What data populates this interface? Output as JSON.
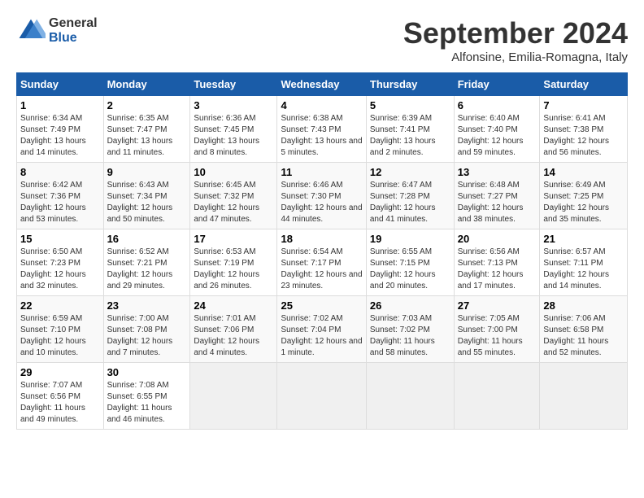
{
  "header": {
    "logo_line1": "General",
    "logo_line2": "Blue",
    "month": "September 2024",
    "location": "Alfonsine, Emilia-Romagna, Italy"
  },
  "columns": [
    "Sunday",
    "Monday",
    "Tuesday",
    "Wednesday",
    "Thursday",
    "Friday",
    "Saturday"
  ],
  "weeks": [
    [
      {
        "day": "1",
        "sunrise": "6:34 AM",
        "sunset": "7:49 PM",
        "daylight": "13 hours and 14 minutes"
      },
      {
        "day": "2",
        "sunrise": "6:35 AM",
        "sunset": "7:47 PM",
        "daylight": "13 hours and 11 minutes"
      },
      {
        "day": "3",
        "sunrise": "6:36 AM",
        "sunset": "7:45 PM",
        "daylight": "13 hours and 8 minutes"
      },
      {
        "day": "4",
        "sunrise": "6:38 AM",
        "sunset": "7:43 PM",
        "daylight": "13 hours and 5 minutes"
      },
      {
        "day": "5",
        "sunrise": "6:39 AM",
        "sunset": "7:41 PM",
        "daylight": "13 hours and 2 minutes"
      },
      {
        "day": "6",
        "sunrise": "6:40 AM",
        "sunset": "7:40 PM",
        "daylight": "12 hours and 59 minutes"
      },
      {
        "day": "7",
        "sunrise": "6:41 AM",
        "sunset": "7:38 PM",
        "daylight": "12 hours and 56 minutes"
      }
    ],
    [
      {
        "day": "8",
        "sunrise": "6:42 AM",
        "sunset": "7:36 PM",
        "daylight": "12 hours and 53 minutes"
      },
      {
        "day": "9",
        "sunrise": "6:43 AM",
        "sunset": "7:34 PM",
        "daylight": "12 hours and 50 minutes"
      },
      {
        "day": "10",
        "sunrise": "6:45 AM",
        "sunset": "7:32 PM",
        "daylight": "12 hours and 47 minutes"
      },
      {
        "day": "11",
        "sunrise": "6:46 AM",
        "sunset": "7:30 PM",
        "daylight": "12 hours and 44 minutes"
      },
      {
        "day": "12",
        "sunrise": "6:47 AM",
        "sunset": "7:28 PM",
        "daylight": "12 hours and 41 minutes"
      },
      {
        "day": "13",
        "sunrise": "6:48 AM",
        "sunset": "7:27 PM",
        "daylight": "12 hours and 38 minutes"
      },
      {
        "day": "14",
        "sunrise": "6:49 AM",
        "sunset": "7:25 PM",
        "daylight": "12 hours and 35 minutes"
      }
    ],
    [
      {
        "day": "15",
        "sunrise": "6:50 AM",
        "sunset": "7:23 PM",
        "daylight": "12 hours and 32 minutes"
      },
      {
        "day": "16",
        "sunrise": "6:52 AM",
        "sunset": "7:21 PM",
        "daylight": "12 hours and 29 minutes"
      },
      {
        "day": "17",
        "sunrise": "6:53 AM",
        "sunset": "7:19 PM",
        "daylight": "12 hours and 26 minutes"
      },
      {
        "day": "18",
        "sunrise": "6:54 AM",
        "sunset": "7:17 PM",
        "daylight": "12 hours and 23 minutes"
      },
      {
        "day": "19",
        "sunrise": "6:55 AM",
        "sunset": "7:15 PM",
        "daylight": "12 hours and 20 minutes"
      },
      {
        "day": "20",
        "sunrise": "6:56 AM",
        "sunset": "7:13 PM",
        "daylight": "12 hours and 17 minutes"
      },
      {
        "day": "21",
        "sunrise": "6:57 AM",
        "sunset": "7:11 PM",
        "daylight": "12 hours and 14 minutes"
      }
    ],
    [
      {
        "day": "22",
        "sunrise": "6:59 AM",
        "sunset": "7:10 PM",
        "daylight": "12 hours and 10 minutes"
      },
      {
        "day": "23",
        "sunrise": "7:00 AM",
        "sunset": "7:08 PM",
        "daylight": "12 hours and 7 minutes"
      },
      {
        "day": "24",
        "sunrise": "7:01 AM",
        "sunset": "7:06 PM",
        "daylight": "12 hours and 4 minutes"
      },
      {
        "day": "25",
        "sunrise": "7:02 AM",
        "sunset": "7:04 PM",
        "daylight": "12 hours and 1 minute"
      },
      {
        "day": "26",
        "sunrise": "7:03 AM",
        "sunset": "7:02 PM",
        "daylight": "11 hours and 58 minutes"
      },
      {
        "day": "27",
        "sunrise": "7:05 AM",
        "sunset": "7:00 PM",
        "daylight": "11 hours and 55 minutes"
      },
      {
        "day": "28",
        "sunrise": "7:06 AM",
        "sunset": "6:58 PM",
        "daylight": "11 hours and 52 minutes"
      }
    ],
    [
      {
        "day": "29",
        "sunrise": "7:07 AM",
        "sunset": "6:56 PM",
        "daylight": "11 hours and 49 minutes"
      },
      {
        "day": "30",
        "sunrise": "7:08 AM",
        "sunset": "6:55 PM",
        "daylight": "11 hours and 46 minutes"
      },
      null,
      null,
      null,
      null,
      null
    ]
  ]
}
